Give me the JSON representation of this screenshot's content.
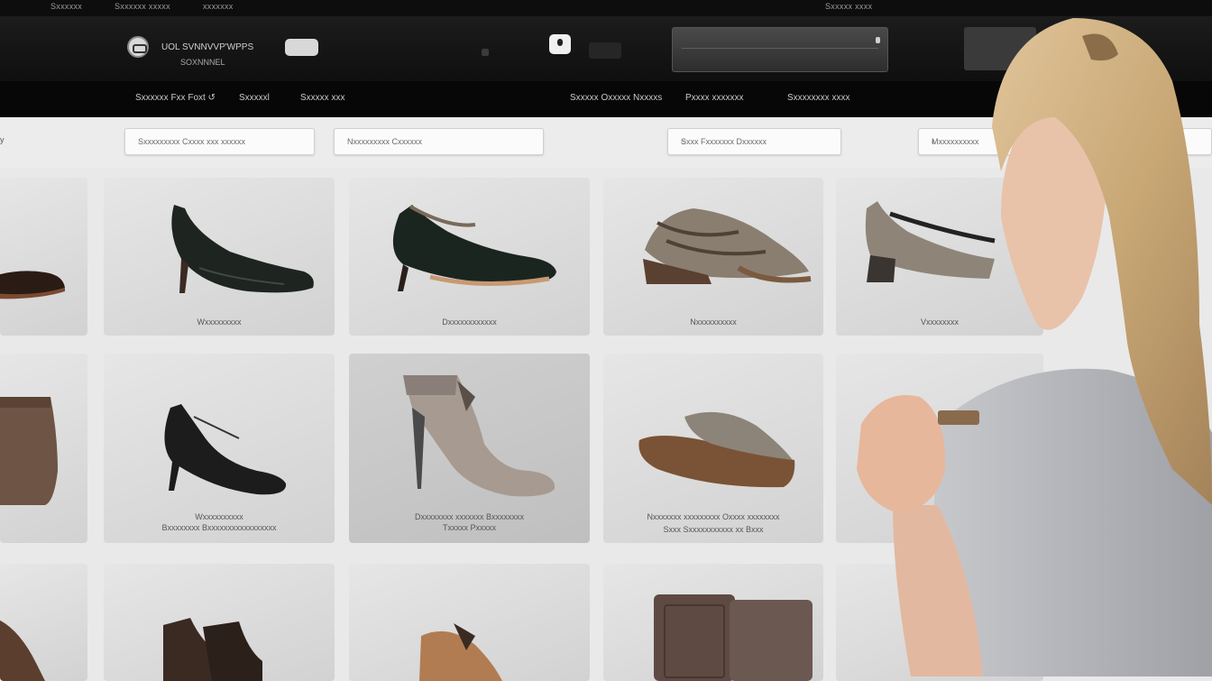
{
  "topbar": {
    "links": [
      "Sxxxxxx",
      "Sxxxxxx  xxxxx",
      "xxxxxxx"
    ],
    "right_text": "Sxxxxx xxxx"
  },
  "header": {
    "brand_name": "UOL SVNNVVP'WPPS",
    "brand_sub": "SOXNNNEL"
  },
  "nav": {
    "items": [
      "Sxxxxxx Fxx Foxt ↺",
      "Sxxxxxl",
      "Sxxxxx xxx",
      "Sxxxxx Oxxxxx Nxxxxs",
      "Pxxxx xxxxxxx",
      "Sxxxxxxxx xxxx"
    ]
  },
  "filters": [
    {
      "label": "Sxxxxxxxxx Cxxxx xxx xxxxxx",
      "control": ""
    },
    {
      "label": "Nxxxxxxxxx Cxxxxxx",
      "control": ""
    },
    {
      "label": "Sxxx Fxxxxxxx Dxxxxxx",
      "control": "◌"
    },
    {
      "label": "Mxxxxxxxxxx",
      "control": "‹"
    }
  ],
  "left_marker": "y",
  "products": [
    {
      "caption_1": "Wxxxxxxxxx",
      "caption_2": ""
    },
    {
      "caption_1": "Dxxxxxxxxxxxx",
      "caption_2": ""
    },
    {
      "caption_1": "Nxxxxxxxxxx",
      "caption_2": ""
    },
    {
      "caption_1": "Vxxxxxxxx",
      "caption_2": ""
    },
    {
      "caption_1": "Wxxxxxxxxxx",
      "caption_2": "Bxxxxxxxx Bxxxxxxxxxxxxxxxxx"
    },
    {
      "caption_1": "Dxxxxxxxx xxxxxxx Bxxxxxxxx",
      "caption_2": "Txxxxx Pxxxxx"
    },
    {
      "caption_1": "Nxxxxxxx xxxxxxxxx Oxxxx xxxxxxxx",
      "caption_2": "Sxxx Sxxxxxxxxxxx xx Bxxx"
    },
    {
      "caption_1": "",
      "caption_2": ""
    },
    {
      "caption_1": "",
      "caption_2": ""
    },
    {
      "caption_1": "",
      "caption_2": ""
    },
    {
      "caption_1": "",
      "caption_2": ""
    },
    {
      "caption_1": "",
      "caption_2": ""
    }
  ],
  "colors": {
    "header_bg": "#111111",
    "nav_bg": "#070707",
    "card_bg": "#d9d9d9",
    "page_bg": "#e9e9e9",
    "hair": "#c9a876"
  },
  "icons": {
    "logo": "brand-logo-icon",
    "header_action": "user-icon",
    "search_control": "chevron-icon"
  }
}
